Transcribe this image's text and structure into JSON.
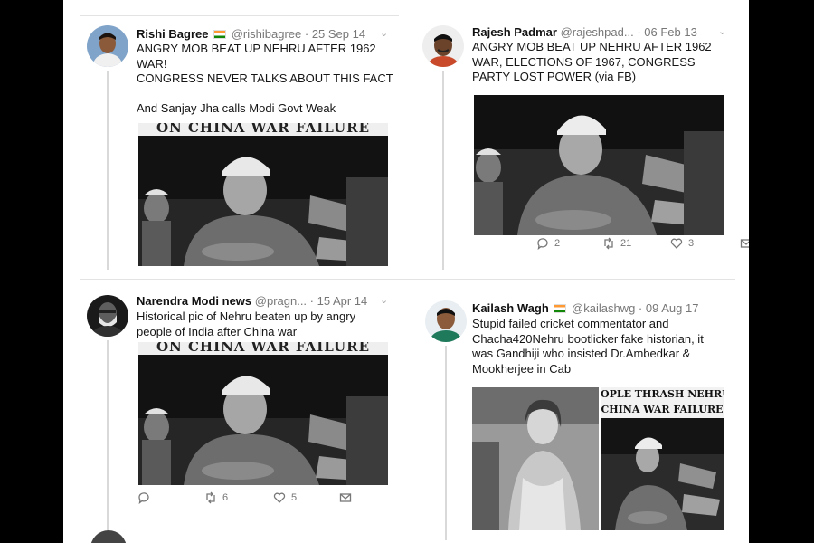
{
  "tweets": {
    "t1": {
      "name": "Rishi Bagree",
      "handle": "@rishibagree",
      "date": "· 25 Sep 14",
      "text": "ANGRY MOB BEAT UP NEHRU AFTER 1962 WAR!\nCONGRESS NEVER TALKS ABOUT THIS FACT\n\nAnd Sanjay Jha calls Modi Govt Weak",
      "image_banner": "ON CHINA WAR FAILURE"
    },
    "t2": {
      "name": "Rajesh Padmar",
      "handle": "@rajeshpad...",
      "date": "· 06 Feb 13",
      "text": "ANGRY MOB BEAT UP NEHRU AFTER 1962 WAR,  ELECTIONS OF 1967, CONGRESS PARTY LOST POWER (via FB)",
      "replies": "2",
      "retweets": "21",
      "likes": "3"
    },
    "t3": {
      "name": "Narendra Modi news",
      "handle": "@pragn...",
      "date": "· 15 Apr 14",
      "text": "Historical pic of Nehru beaten up by angry people of India after China war",
      "image_banner": "ON CHINA WAR FAILURE",
      "replies": "",
      "retweets": "6",
      "likes": "5"
    },
    "t4": {
      "name": "Kailash Wagh",
      "handle": "@kailashwg",
      "date": "· 09 Aug 17",
      "text": "Stupid failed cricket commentator and Chacha420Nehru bootlicker fake historian, it was Gandhiji who insisted Dr.Ambedkar & Mookherjee in Cab",
      "image_banner_line1": "OPLE THRASH NEHRU",
      "image_banner_line2": "CHINA WAR FAILURE"
    }
  },
  "icons": {
    "reply": "reply-icon",
    "retweet": "retweet-icon",
    "like": "heart-icon",
    "dm": "message-icon",
    "chevron": "chevron-down-icon",
    "flag": "india-flag-icon"
  }
}
